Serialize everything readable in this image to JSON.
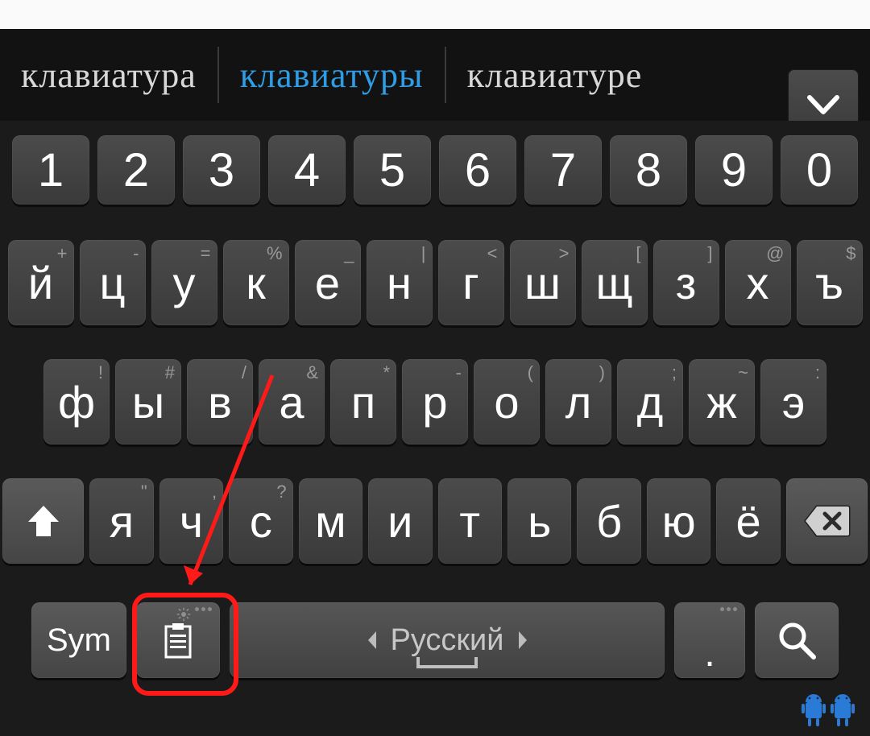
{
  "suggestions": {
    "items": [
      "клавиатура",
      "клавиатуры",
      "клавиатуре"
    ],
    "selected_index": 1
  },
  "rows": {
    "numbers": [
      "1",
      "2",
      "3",
      "4",
      "5",
      "6",
      "7",
      "8",
      "9",
      "0"
    ],
    "r2": [
      {
        "m": "й",
        "a": "+"
      },
      {
        "m": "ц",
        "a": "-"
      },
      {
        "m": "у",
        "a": "="
      },
      {
        "m": "к",
        "a": "%"
      },
      {
        "m": "е",
        "a": "_"
      },
      {
        "m": "н",
        "a": "|"
      },
      {
        "m": "г",
        "a": "<"
      },
      {
        "m": "ш",
        "a": ">"
      },
      {
        "m": "щ",
        "a": "["
      },
      {
        "m": "з",
        "a": "]"
      },
      {
        "m": "х",
        "a": "@"
      },
      {
        "m": "ъ",
        "a": "$"
      }
    ],
    "r3": [
      {
        "m": "ф",
        "a": "!"
      },
      {
        "m": "ы",
        "a": "#"
      },
      {
        "m": "в",
        "a": "/"
      },
      {
        "m": "а",
        "a": "&"
      },
      {
        "m": "п",
        "a": "*"
      },
      {
        "m": "р",
        "a": "-"
      },
      {
        "m": "о",
        "a": "("
      },
      {
        "m": "л",
        "a": ")"
      },
      {
        "m": "д",
        "a": ";"
      },
      {
        "m": "ж",
        "a": "~"
      },
      {
        "m": "э",
        "a": ":"
      }
    ],
    "r4": [
      {
        "m": "я",
        "a": "\""
      },
      {
        "m": "ч",
        "a": ","
      },
      {
        "m": "с",
        "a": "?"
      },
      {
        "m": "м",
        "a": ""
      },
      {
        "m": "и",
        "a": ""
      },
      {
        "m": "т",
        "a": ""
      },
      {
        "m": "ь",
        "a": ""
      },
      {
        "m": "б",
        "a": ""
      },
      {
        "m": "ю",
        "a": ""
      },
      {
        "m": "ё",
        "a": ""
      }
    ]
  },
  "bottom": {
    "sym": "Sym",
    "space_language": "Русский",
    "dot": "."
  }
}
